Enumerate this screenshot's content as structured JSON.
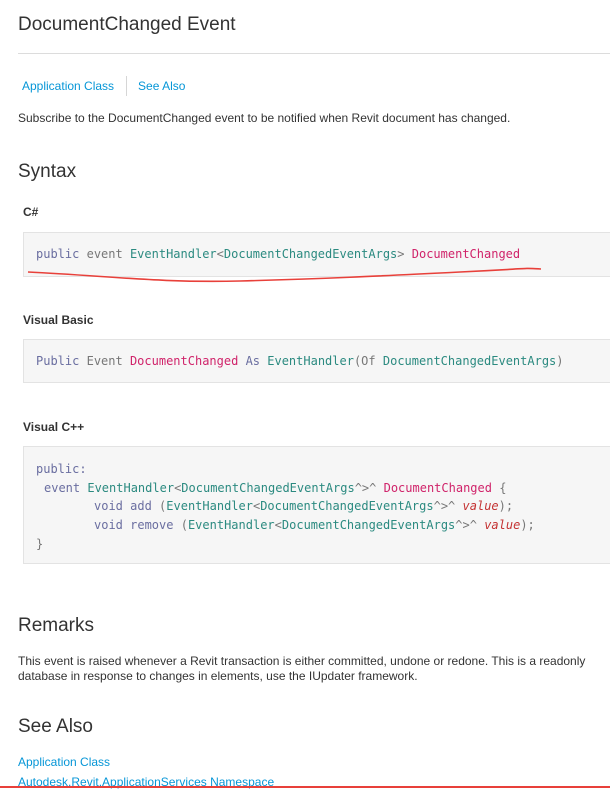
{
  "page": {
    "title": "DocumentChanged Event",
    "breadcrumb": {
      "class_link": "Application Class",
      "see_also_link": "See Also"
    },
    "summary": "Subscribe to the DocumentChanged event to be notified when Revit document has changed."
  },
  "syntax": {
    "heading": "Syntax",
    "csharp": {
      "label": "C#",
      "tokens": [
        "public",
        "event",
        "EventHandler",
        "<",
        "DocumentChangedEventArgs",
        ">",
        "DocumentChanged"
      ]
    },
    "vb": {
      "label": "Visual Basic",
      "tokens": [
        "Public",
        "Event",
        "DocumentChanged",
        "As",
        "EventHandler",
        "(Of",
        "DocumentChangedEventArgs",
        ")"
      ]
    },
    "cpp": {
      "label": "Visual C++",
      "line1": "public:",
      "line2": {
        "kw": "event",
        "type": "EventHandler",
        "lt": "<",
        "arg": "DocumentChangedEventArgs",
        "hat": "^>^",
        "name": "DocumentChanged",
        "brace": "{"
      },
      "line3": {
        "kw": "void add",
        "paren": "(",
        "type": "EventHandler",
        "lt": "<",
        "arg": "DocumentChangedEventArgs",
        "hat": "^>^",
        "param": "value",
        "end": ");"
      },
      "line4": {
        "kw": "void remove",
        "paren": "(",
        "type": "EventHandler",
        "lt": "<",
        "arg": "DocumentChangedEventArgs",
        "hat": "^>^",
        "param": "value",
        "end": ");"
      },
      "line5": "}"
    }
  },
  "remarks": {
    "heading": "Remarks",
    "line1": "This event is raised whenever a Revit transaction is either committed, undone or redone. This is a readonly",
    "line2": "database in response to changes in elements, use the IUpdater framework."
  },
  "see_also": {
    "heading": "See Also",
    "links": [
      "Application Class",
      "Autodesk.Revit.ApplicationServices Namespace"
    ]
  },
  "colors": {
    "link": "#0696d7",
    "keyword": "#6a6ea0",
    "type": "#2b8a80",
    "member": "#d0236a",
    "param": "#c43232",
    "annotation": "#e8403a"
  }
}
